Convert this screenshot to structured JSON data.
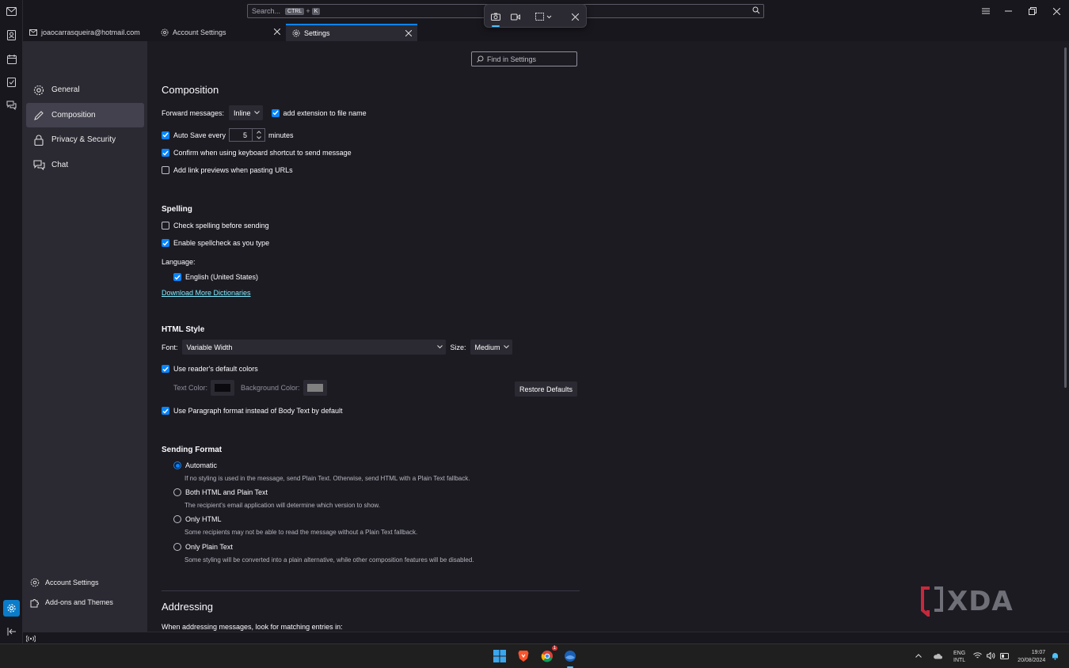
{
  "titlebar": {
    "search_placeholder": "Search...",
    "search_shortcut_key1": "CTRL",
    "search_shortcut_plus": "+",
    "search_shortcut_key2": "K"
  },
  "tabs": [
    {
      "label": "joaocarrasqueira@hotmail.com"
    },
    {
      "label": "Account Settings"
    },
    {
      "label": "Settings"
    }
  ],
  "nav": {
    "items": [
      {
        "label": "General"
      },
      {
        "label": "Composition"
      },
      {
        "label": "Privacy & Security"
      },
      {
        "label": "Chat"
      }
    ],
    "bottom": [
      {
        "label": "Account Settings"
      },
      {
        "label": "Add-ons and Themes"
      }
    ]
  },
  "find_placeholder": "Find in Settings",
  "composition": {
    "title": "Composition",
    "forward_label": "Forward messages:",
    "forward_value": "Inline",
    "add_extension": "add extension to file name",
    "autosave_label": "Auto Save every",
    "autosave_value": "5",
    "autosave_unit": "minutes",
    "confirm_shortcut": "Confirm when using keyboard shortcut to send message",
    "link_previews": "Add link previews when pasting URLs"
  },
  "spelling": {
    "title": "Spelling",
    "check_before": "Check spelling before sending",
    "spellcheck_type": "Enable spellcheck as you type",
    "language_label": "Language:",
    "language_value": "English (United States)",
    "download_link": "Download More Dictionaries"
  },
  "html_style": {
    "title": "HTML Style",
    "font_label": "Font:",
    "font_value": "Variable Width",
    "size_label": "Size:",
    "size_value": "Medium",
    "reader_colors": "Use reader's default colors",
    "text_color_label": "Text Color:",
    "bg_color_label": "Background Color:",
    "text_color": "#0b0b0f",
    "bg_color": "#808080",
    "restore_defaults": "Restore Defaults",
    "paragraph_format": "Use Paragraph format instead of Body Text by default"
  },
  "sending_format": {
    "title": "Sending Format",
    "options": [
      {
        "label": "Automatic",
        "desc": "If no styling is used in the message, send Plain Text. Otherwise, send HTML with a Plain Text fallback."
      },
      {
        "label": "Both HTML and Plain Text",
        "desc": "The recipient's email application will determine which version to show."
      },
      {
        "label": "Only HTML",
        "desc": "Some recipients may not be able to read the message without a Plain Text fallback."
      },
      {
        "label": "Only Plain Text",
        "desc": "Some styling will be converted into a plain alternative, while other composition features will be disabled."
      }
    ]
  },
  "addressing": {
    "title": "Addressing",
    "subtitle": "When addressing messages, look for matching entries in:"
  },
  "taskbar": {
    "lang1": "ENG",
    "lang2": "INTL",
    "time": "19:07",
    "date": "20/08/2024",
    "badge": "1"
  },
  "watermark": "XDA",
  "colors": {
    "accent": "#0a84ff",
    "link": "#80ebff"
  }
}
